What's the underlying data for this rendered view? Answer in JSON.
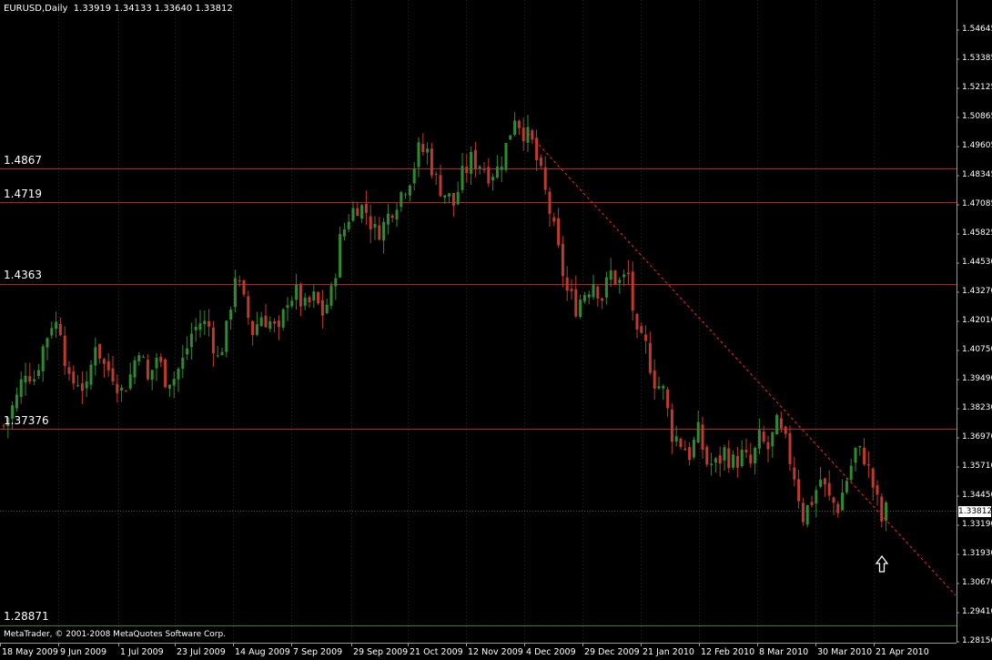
{
  "header": {
    "symbol": "EURUSD,Daily",
    "ohlc": "1.33919 1.34133 1.33640 1.33812"
  },
  "footer": {
    "copyright": "MetaTrader, © 2001-2008 MetaQuotes Software Corp."
  },
  "colors": {
    "background": "#000000",
    "bull": "#2e8b2e",
    "bear": "#c0392b",
    "level_line": "#b22222",
    "trend_line": "#ff2020",
    "axis": "#9a9a9a",
    "bottom_line": "#228b22"
  },
  "levels": [
    {
      "label": "1.4867",
      "value": 1.4867
    },
    {
      "label": "1.4719",
      "value": 1.4719
    },
    {
      "label": "1.4363",
      "value": 1.4363
    },
    {
      "label": "1.37376",
      "value": 1.37376
    },
    {
      "label": "1.28871",
      "value": 1.28871
    }
  ],
  "current_price": "1.33812",
  "marker_icon": "up-arrow-icon",
  "chart_data": {
    "type": "candlestick",
    "title": "EURUSD,Daily",
    "ylim": [
      1.2815,
      1.5465
    ],
    "y_ticks": [
      "1.54645",
      "1.53385",
      "1.52125",
      "1.50865",
      "1.49605",
      "1.48345",
      "1.47085",
      "1.45825",
      "1.44530",
      "1.43270",
      "1.42010",
      "1.40750",
      "1.39490",
      "1.38230",
      "1.36970",
      "1.35710",
      "1.34450",
      "1.33190",
      "1.31930",
      "1.30670",
      "1.29410",
      "1.28150"
    ],
    "x_ticks": [
      "18 May 2009",
      "9 Jun 2009",
      "1 Jul 2009",
      "23 Jul 2009",
      "14 Aug 2009",
      "7 Sep 2009",
      "29 Sep 2009",
      "21 Oct 2009",
      "12 Nov 2009",
      "4 Dec 2009",
      "29 Dec 2009",
      "21 Jan 2010",
      "12 Feb 2010",
      "8 Mar 2010",
      "30 Mar 2010",
      "21 Apr 2010"
    ],
    "close_path": [
      [
        0,
        1.375
      ],
      [
        3,
        1.387
      ],
      [
        5,
        1.4
      ],
      [
        7,
        1.396
      ],
      [
        9,
        1.409
      ],
      [
        11,
        1.42
      ],
      [
        13,
        1.418
      ],
      [
        15,
        1.393
      ],
      [
        17,
        1.395
      ],
      [
        19,
        1.39
      ],
      [
        21,
        1.412
      ],
      [
        23,
        1.401
      ],
      [
        25,
        1.398
      ],
      [
        27,
        1.39
      ],
      [
        29,
        1.397
      ],
      [
        31,
        1.41
      ],
      [
        33,
        1.394
      ],
      [
        35,
        1.405
      ],
      [
        37,
        1.396
      ],
      [
        39,
        1.396
      ],
      [
        41,
        1.403
      ],
      [
        43,
        1.415
      ],
      [
        45,
        1.42
      ],
      [
        47,
        1.418
      ],
      [
        49,
        1.404
      ],
      [
        51,
        1.416
      ],
      [
        53,
        1.441
      ],
      [
        55,
        1.428
      ],
      [
        57,
        1.416
      ],
      [
        59,
        1.423
      ],
      [
        61,
        1.42
      ],
      [
        63,
        1.414
      ],
      [
        65,
        1.431
      ],
      [
        67,
        1.432
      ],
      [
        69,
        1.426
      ],
      [
        71,
        1.43
      ],
      [
        73,
        1.424
      ],
      [
        75,
        1.432
      ],
      [
        77,
        1.455
      ],
      [
        79,
        1.466
      ],
      [
        81,
        1.471
      ],
      [
        83,
        1.468
      ],
      [
        85,
        1.459
      ],
      [
        87,
        1.462
      ],
      [
        89,
        1.47
      ],
      [
        91,
        1.476
      ],
      [
        93,
        1.483
      ],
      [
        95,
        1.494
      ],
      [
        97,
        1.494
      ],
      [
        99,
        1.481
      ],
      [
        101,
        1.476
      ],
      [
        103,
        1.471
      ],
      [
        105,
        1.483
      ],
      [
        107,
        1.49
      ],
      [
        109,
        1.489
      ],
      [
        111,
        1.485
      ],
      [
        113,
        1.486
      ],
      [
        115,
        1.496
      ],
      [
        117,
        1.51
      ],
      [
        119,
        1.503
      ],
      [
        121,
        1.497
      ],
      [
        123,
        1.483
      ],
      [
        125,
        1.468
      ],
      [
        127,
        1.45
      ],
      [
        129,
        1.433
      ],
      [
        131,
        1.427
      ],
      [
        133,
        1.433
      ],
      [
        135,
        1.438
      ],
      [
        137,
        1.431
      ],
      [
        139,
        1.441
      ],
      [
        141,
        1.437
      ],
      [
        143,
        1.44
      ],
      [
        145,
        1.412
      ],
      [
        147,
        1.409
      ],
      [
        149,
        1.395
      ],
      [
        151,
        1.39
      ],
      [
        153,
        1.372
      ],
      [
        155,
        1.368
      ],
      [
        157,
        1.363
      ],
      [
        159,
        1.372
      ],
      [
        161,
        1.359
      ],
      [
        163,
        1.358
      ],
      [
        165,
        1.364
      ],
      [
        167,
        1.359
      ],
      [
        169,
        1.362
      ],
      [
        171,
        1.358
      ],
      [
        173,
        1.369
      ],
      [
        175,
        1.365
      ],
      [
        177,
        1.375
      ],
      [
        179,
        1.367
      ],
      [
        181,
        1.354
      ],
      [
        183,
        1.336
      ],
      [
        185,
        1.343
      ],
      [
        187,
        1.352
      ],
      [
        189,
        1.343
      ],
      [
        191,
        1.34
      ],
      [
        193,
        1.352
      ],
      [
        195,
        1.364
      ],
      [
        197,
        1.362
      ],
      [
        199,
        1.349
      ],
      [
        201,
        1.334
      ],
      [
        202,
        1.338
      ]
    ]
  }
}
